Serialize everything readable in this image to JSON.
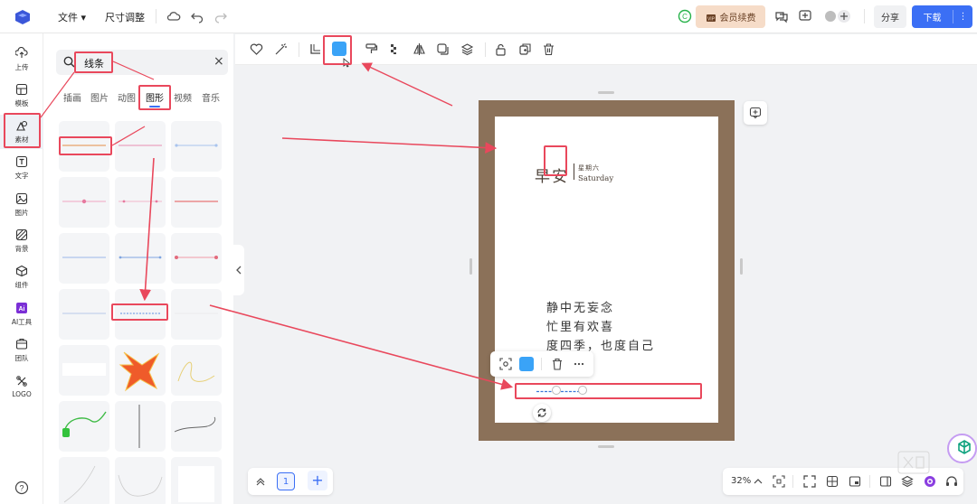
{
  "header": {
    "file_menu": "文件",
    "size_menu": "尺寸调整",
    "vip_label": "会员续费",
    "share_label": "分享",
    "download_label": "下载",
    "more_icon": "⋮"
  },
  "rail": {
    "items": [
      {
        "label": "上传",
        "icon": "upload-icon"
      },
      {
        "label": "模板",
        "icon": "template-icon"
      },
      {
        "label": "素材",
        "icon": "shapes-icon"
      },
      {
        "label": "文字",
        "icon": "text-icon"
      },
      {
        "label": "图片",
        "icon": "image-icon"
      },
      {
        "label": "背景",
        "icon": "background-icon"
      },
      {
        "label": "组件",
        "icon": "component-icon"
      },
      {
        "label": "AI工具",
        "icon": "ai-icon"
      },
      {
        "label": "团队",
        "icon": "team-icon"
      },
      {
        "label": "LOGO",
        "icon": "logo-icon"
      }
    ],
    "active": "素材"
  },
  "panel": {
    "search_value": "线条",
    "clear_icon": "×",
    "tabs": [
      "插画",
      "图片",
      "动图",
      "图形",
      "视频",
      "音乐"
    ],
    "active_tab": "图形"
  },
  "poster": {
    "greeting": "早安",
    "weekday": "星期六",
    "weekday_en": "Saturday",
    "poem": [
      "静中无妄念",
      "忙里有欢喜",
      "度四季，也度自己"
    ]
  },
  "colors": {
    "accent": "#3b6ff5",
    "selected_line_color": "#3aa3f7",
    "annotation_red": "#e9485c",
    "poster_frame": "#8b7159"
  },
  "pagination": {
    "current_page": "1",
    "add_icon": "+"
  },
  "zoom": {
    "value": "32%"
  }
}
